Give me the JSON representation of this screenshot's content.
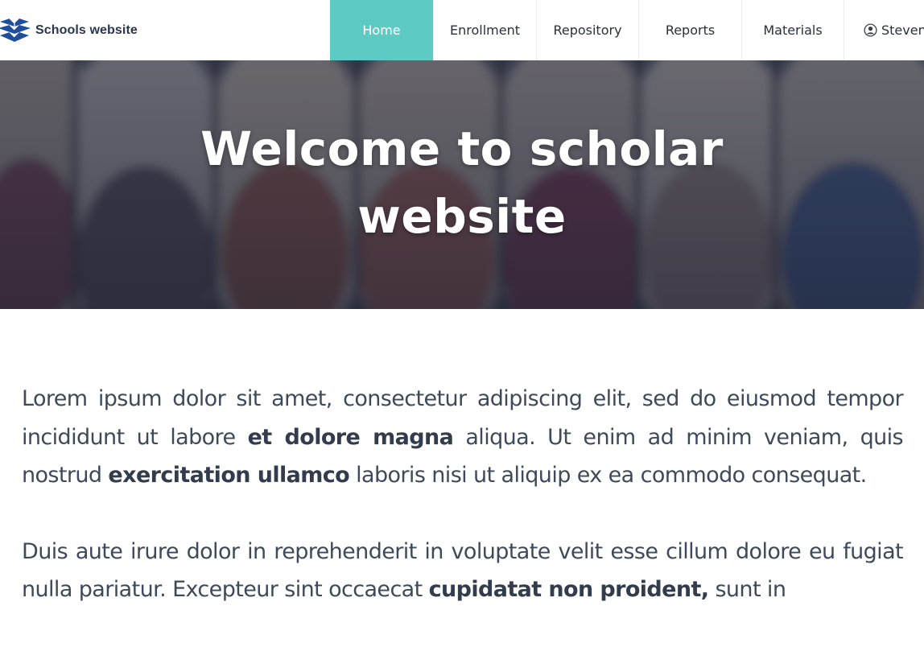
{
  "brand": {
    "name": "Schools website",
    "logo_icon": "book-stack-logo"
  },
  "nav": {
    "items": [
      {
        "label": "Home",
        "active": true
      },
      {
        "label": "Enrollment",
        "active": false
      },
      {
        "label": "Repository",
        "active": false
      },
      {
        "label": "Reports",
        "active": false
      },
      {
        "label": "Materials",
        "active": false
      }
    ],
    "user": {
      "name": "Steven",
      "icon": "user-circle-icon"
    }
  },
  "hero": {
    "title_line1": "Welcome to scholar",
    "title_line2": "website",
    "background": "chalk-sticks-photo"
  },
  "content": {
    "paragraph1": {
      "t1": "Lorem ipsum dolor sit amet, consectetur adipiscing elit, sed do eiusmod tempor incididunt ut labore ",
      "b1": "et dolore magna",
      "t2": " aliqua. Ut enim ad minim veniam, quis nostrud ",
      "b2": "exercitation ullamco",
      "t3": " laboris nisi ut aliquip ex ea commodo consequat."
    },
    "paragraph2": {
      "t1": "Duis aute irure dolor in reprehenderit in voluptate velit esse cillum dolore eu fugiat nulla pariatur. Excepteur sint occaecat ",
      "b1": "cupidatat non proident,",
      "t2": " sunt in"
    }
  },
  "colors": {
    "accent": "#5ecac4",
    "brand_text": "#2a3550",
    "body_text": "#3e4a5c"
  }
}
